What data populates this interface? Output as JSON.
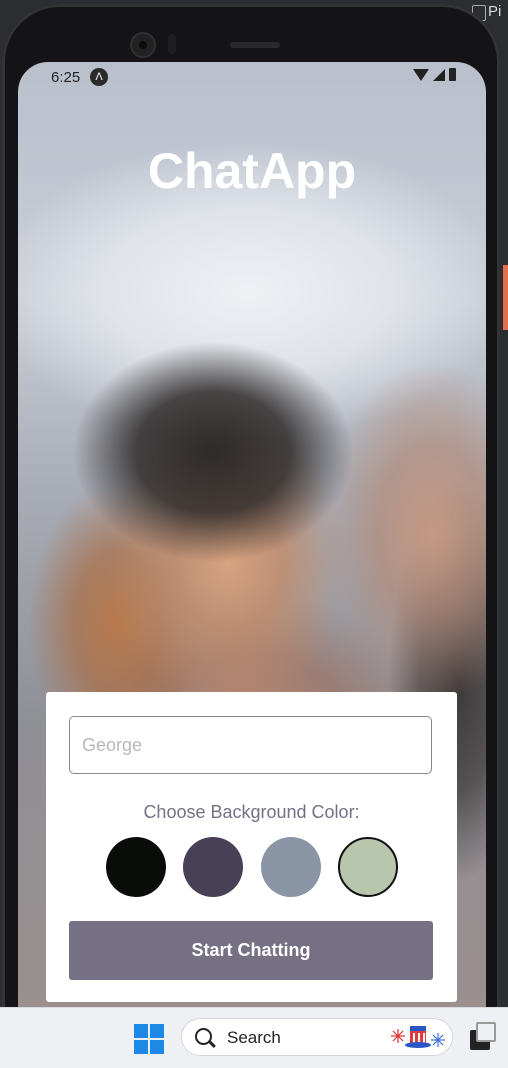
{
  "desktop": {
    "window_title": "Pi"
  },
  "status_bar": {
    "time": "6:25",
    "app_icon": "app-notification-icon",
    "icons": [
      "wifi-icon",
      "signal-icon",
      "battery-icon"
    ]
  },
  "app": {
    "title": "ChatApp",
    "name_input": {
      "placeholder": "George",
      "value": ""
    },
    "color_label": "Choose Background Color:",
    "color_options": [
      {
        "name": "black",
        "color": "#090C08",
        "selected": false
      },
      {
        "name": "dark-purple",
        "color": "#474056",
        "selected": false
      },
      {
        "name": "gray-blue",
        "color": "#8A95A5",
        "selected": false
      },
      {
        "name": "sage-green",
        "color": "#B9C6AE",
        "selected": true
      }
    ],
    "button_label": "Start Chatting",
    "accent_color": "#757083"
  },
  "taskbar": {
    "search_label": "Search",
    "icons": [
      "windows-start-icon",
      "search-icon",
      "holiday-hat-icon",
      "task-view-icon"
    ]
  }
}
